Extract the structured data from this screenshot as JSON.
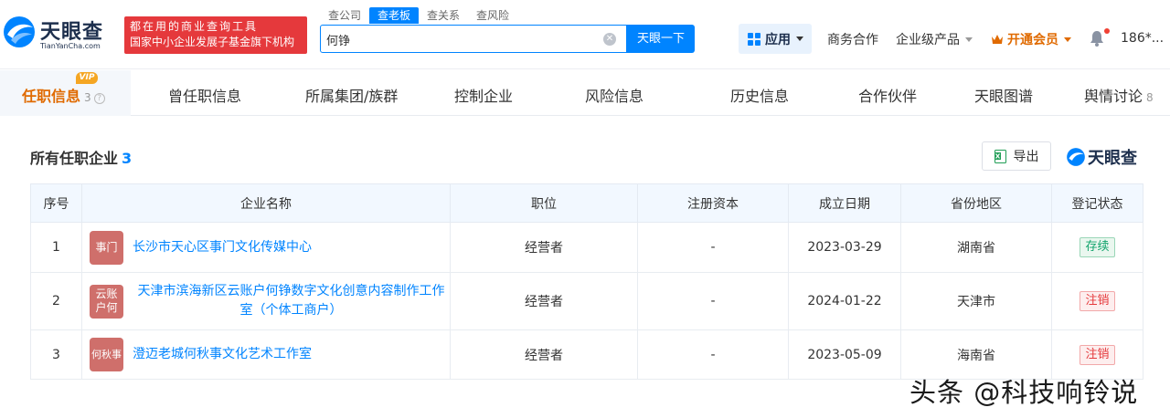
{
  "brand": {
    "name": "天眼查",
    "domain": "TianYanCha.com",
    "slogan_line1": "都在用的商业查询工具",
    "slogan_line2": "国家中小企业发展子基金旗下机构"
  },
  "search": {
    "tabs": [
      "查公司",
      "查老板",
      "查关系",
      "查风险"
    ],
    "active_tab": 1,
    "value": "何铮",
    "button": "天眼一下"
  },
  "topnav": {
    "apps": "应用",
    "business": "商务合作",
    "enterprise": "企业级产品",
    "vip": "开通会员",
    "user": "186*..."
  },
  "subnav": {
    "vip_badge": "VIP",
    "active": {
      "label": "任职信息",
      "count": "3"
    },
    "items": [
      "曾任职信息",
      "所属集团/族群",
      "控制企业",
      "风险信息",
      "历史信息",
      "合作伙伴",
      "天眼图谱",
      "舆情讨论"
    ],
    "last_count": "8"
  },
  "section": {
    "title": "所有任职企业",
    "count": "3",
    "export": "导出",
    "watermark_logo": "天眼查"
  },
  "table": {
    "headers": [
      "序号",
      "企业名称",
      "职位",
      "注册资本",
      "成立日期",
      "省份地区",
      "登记状态"
    ],
    "rows": [
      {
        "no": "1",
        "logo": "事门",
        "name": "长沙市天心区事门文化传媒中心",
        "position": "经营者",
        "capital": "-",
        "date": "2023-03-29",
        "region": "湖南省",
        "status": "存续"
      },
      {
        "no": "2",
        "logo": "云账\n户何",
        "name": "天津市滨海新区云账户何铮数字文化创意内容制作工作室（个体工商户）",
        "position": "经营者",
        "capital": "-",
        "date": "2024-01-22",
        "region": "天津市",
        "status": "注销"
      },
      {
        "no": "3",
        "logo": "何秋事",
        "name": "澄迈老城何秋事文化艺术工作室",
        "position": "经营者",
        "capital": "-",
        "date": "2023-05-09",
        "region": "海南省",
        "status": "注销"
      }
    ]
  },
  "watermark": "头条 @科技响铃说",
  "colors": {
    "primary": "#0084ff",
    "vip_orange": "#e06a00",
    "slogan_red": "#e5393c",
    "status_green": "#10a36b",
    "status_red": "#e5393c",
    "logo_tile": "#cf6f6b"
  }
}
